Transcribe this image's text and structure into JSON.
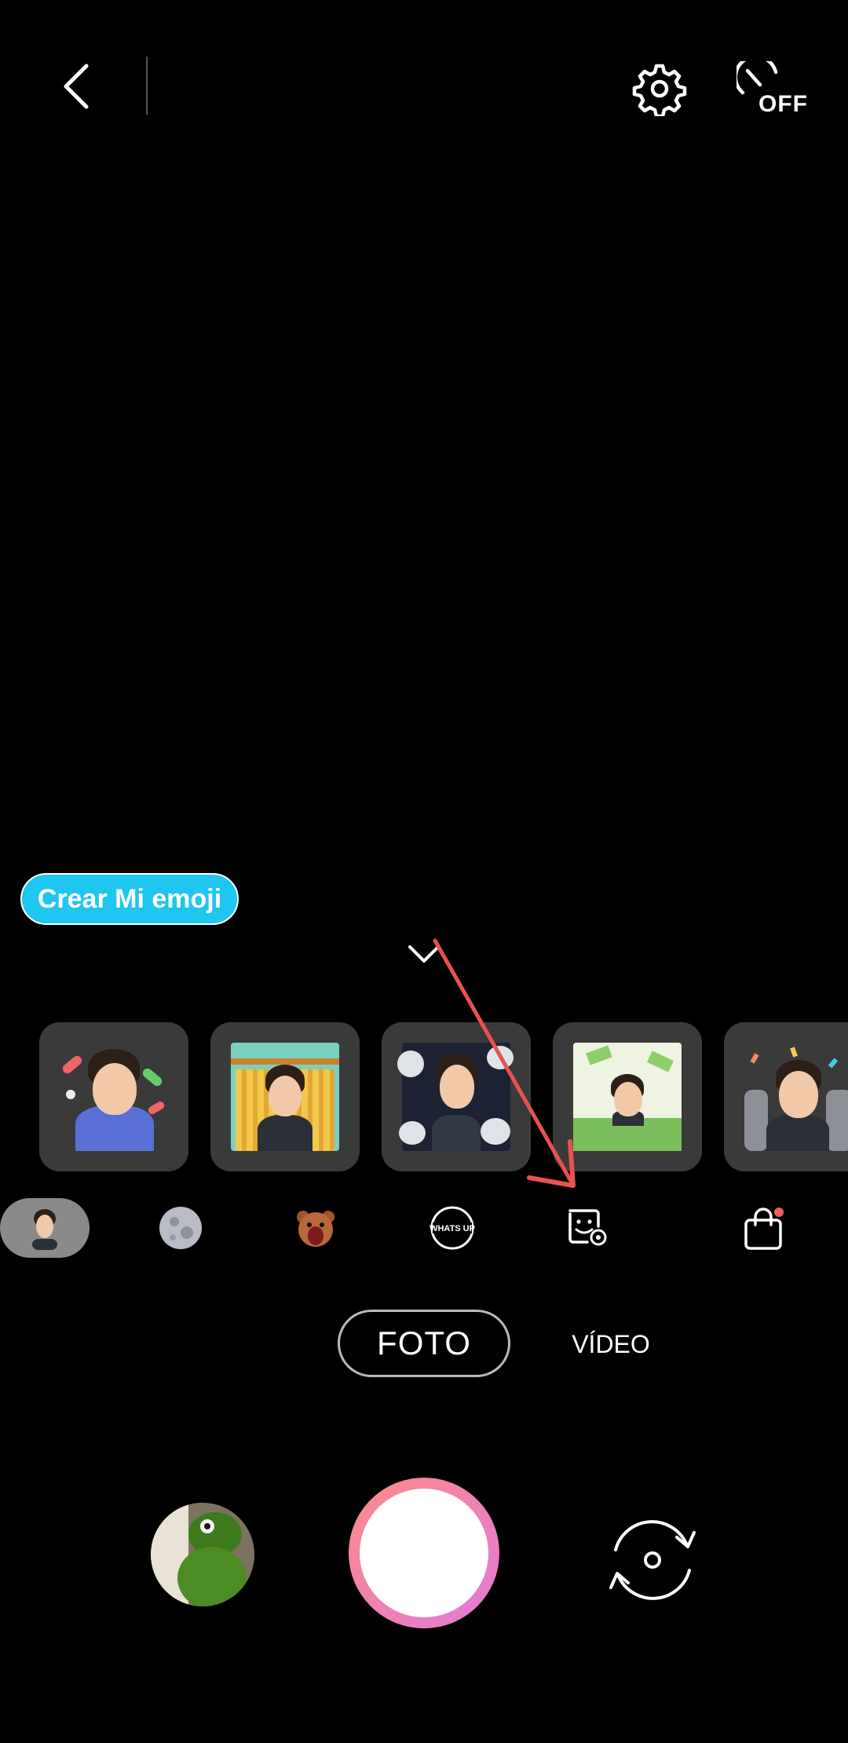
{
  "top_bar": {
    "back_icon": "chevron-left-icon",
    "settings_icon": "gear-icon",
    "timer_icon": "timer-off-icon",
    "timer_label": "OFF"
  },
  "create_emoji": {
    "label": "Crear Mi emoji",
    "color": "#1ec6f0"
  },
  "collapse_icon": "chevron-down-icon",
  "stickers": [
    {
      "name": "sticker-pills"
    },
    {
      "name": "sticker-noodles"
    },
    {
      "name": "sticker-clouds"
    },
    {
      "name": "sticker-money"
    },
    {
      "name": "sticker-celebrate"
    }
  ],
  "categories": [
    {
      "name": "my-emoji",
      "selected": true
    },
    {
      "name": "moon"
    },
    {
      "name": "bear"
    },
    {
      "name": "whats-up"
    },
    {
      "name": "sticker-settings"
    },
    {
      "name": "store"
    }
  ],
  "whatsup_label": "WHATS UP",
  "modes": {
    "photo": "FOTO",
    "video": "VÍDEO",
    "active": "photo"
  },
  "bottom": {
    "gallery_icon": "gallery-thumbnail",
    "flip_icon": "switch-camera-icon"
  },
  "annotation_color": "#e8524f"
}
